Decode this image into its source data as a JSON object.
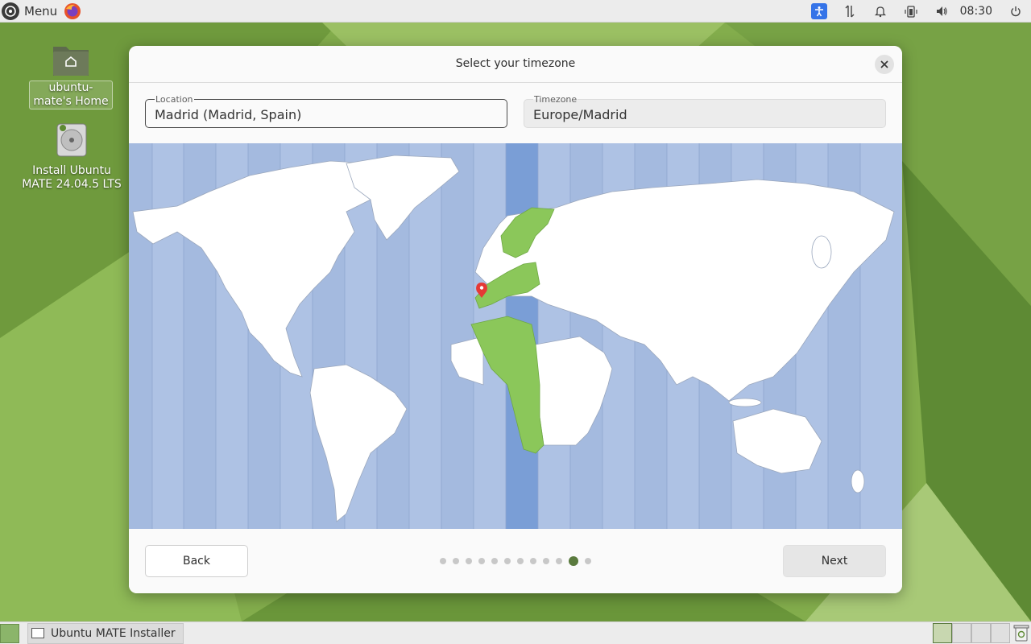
{
  "top_panel": {
    "menu_label": "Menu",
    "clock": "08:30",
    "tray_icons": [
      "accessibility-icon",
      "network-icon",
      "notification-icon",
      "battery-icon",
      "volume-icon",
      "power-icon"
    ]
  },
  "desktop": {
    "icons": [
      {
        "label": "ubuntu-mate's Home",
        "icon": "home-folder-icon"
      },
      {
        "label": "Install Ubuntu MATE 24.04.5 LTS",
        "icon": "disk-installer-icon"
      }
    ]
  },
  "dialog": {
    "title": "Select your timezone",
    "location": {
      "label": "Location",
      "value": "Madrid (Madrid, Spain)"
    },
    "timezone": {
      "label": "Timezone",
      "value": "Europe/Madrid"
    },
    "back_label": "Back",
    "next_label": "Next",
    "steps_total": 12,
    "current_step": 11
  },
  "taskbar": {
    "window_label": "Ubuntu MATE Installer"
  },
  "colors": {
    "ocean": "#aec2e4",
    "selected_zone": "#7a9ed6",
    "highlight_land": "#8bc75a",
    "accent_step": "#5a7a3e"
  }
}
